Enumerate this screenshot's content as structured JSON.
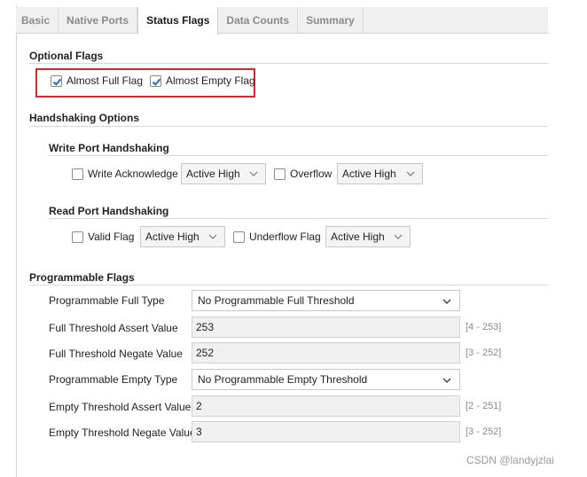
{
  "tabs": [
    {
      "label": "Basic"
    },
    {
      "label": "Native Ports"
    },
    {
      "label": "Status Flags",
      "active": true
    },
    {
      "label": "Data Counts"
    },
    {
      "label": "Summary"
    }
  ],
  "optional_flags": {
    "title": "Optional Flags",
    "almost_full": {
      "label": "Almost Full Flag",
      "checked": true
    },
    "almost_empty": {
      "label": "Almost Empty Flag",
      "checked": true
    }
  },
  "handshaking": {
    "title": "Handshaking Options",
    "write": {
      "title": "Write Port Handshaking",
      "ack_label": "Write Acknowledge",
      "ack_select": "Active High",
      "overflow_label": "Overflow",
      "overflow_select": "Active High"
    },
    "read": {
      "title": "Read Port Handshaking",
      "valid_label": "Valid Flag",
      "valid_select": "Active High",
      "underflow_label": "Underflow Flag",
      "underflow_select": "Active High"
    }
  },
  "programmable": {
    "title": "Programmable Flags",
    "full_type_label": "Programmable Full Type",
    "full_type_value": "No Programmable Full Threshold",
    "full_assert_label": "Full Threshold Assert Value",
    "full_assert_value": "253",
    "full_assert_range": "[4 - 253]",
    "full_negate_label": "Full Threshold Negate Value",
    "full_negate_value": "252",
    "full_negate_range": "[3 - 252]",
    "empty_type_label": "Programmable Empty Type",
    "empty_type_value": "No Programmable Empty Threshold",
    "empty_assert_label": "Empty Threshold Assert Value",
    "empty_assert_value": "2",
    "empty_assert_range": "[2 - 251]",
    "empty_negate_label": "Empty Threshold Negate Value",
    "empty_negate_value": "3",
    "empty_negate_range": "[3 - 252]"
  },
  "watermark": "CSDN @landyjzlai",
  "colors": {
    "highlight_box": "#e0242b",
    "checkbox_check": "#1f6fc5"
  }
}
